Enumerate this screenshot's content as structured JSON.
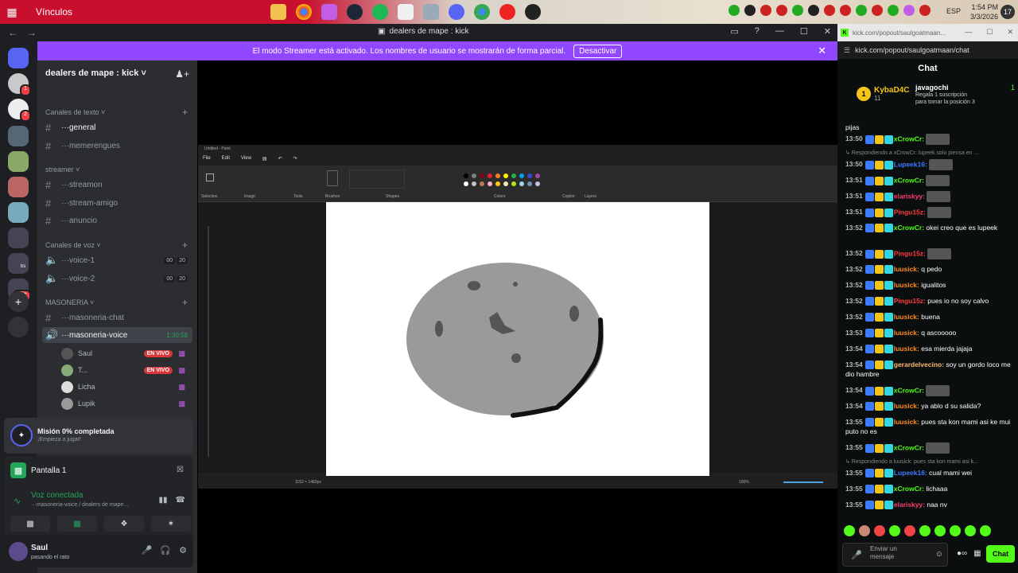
{
  "taskbar": {
    "label": "Vínculos",
    "lang": "ESP",
    "time": "1:54 PM",
    "date": "3/3/2026",
    "badge": "17"
  },
  "discord": {
    "window_title": "dealers de mape : kick",
    "banner_text": "El modo Streamer está activado. Los nombres de usuario se mostrarán de forma parcial.",
    "banner_button": "Desactivar",
    "server_name": "dealers de mape : kick",
    "guild_badges": [
      "1",
      "2",
      "1K+"
    ],
    "guild_label": "bs",
    "categories": {
      "text": "Canales de texto",
      "streamer": "streamer",
      "voice": "Canales de voz",
      "masoneria": "MASONERIA"
    },
    "text_channels": [
      "···general",
      "···memerengues"
    ],
    "streamer_channels": [
      "···streamon",
      "···stream-amigo",
      "···anuncio"
    ],
    "voice_channels": [
      {
        "name": "···voice-1",
        "a": "00",
        "b": "20"
      },
      {
        "name": "···voice-2",
        "a": "00",
        "b": "20"
      }
    ],
    "masoneria_chat": "···masoneria-chat",
    "masoneria_voice": "···masoneria-voice",
    "masoneria_timer": "1:30:59",
    "voice_users": [
      {
        "name": "Saul",
        "live": "EN VIVO"
      },
      {
        "name": "T...",
        "live": "EN VIVO"
      },
      {
        "name": "Licha",
        "live": ""
      },
      {
        "name": "Lupik",
        "live": ""
      }
    ],
    "mission_title": "Misión 0% completada",
    "mission_sub": "¡Empieza a jugar!",
    "screen_label": "Pantalla 1",
    "voice_status": "Voz conectada",
    "voice_sub": "···masoneria-voice / dealers de mape...",
    "user_name": "Saul",
    "user_status": "pasando el rato"
  },
  "paint": {
    "title": "Untitled - Paint",
    "menu": [
      "File",
      "Edit",
      "View"
    ],
    "groups": [
      "Selection",
      "Image",
      "Tools",
      "Brushes",
      "Shapes",
      "Colors",
      "Copilot",
      "Layers"
    ],
    "size": "1152 × 1483px",
    "zoom": "100%",
    "swatch_colors": [
      "#000000",
      "#7f7f7f",
      "#880015",
      "#ed1c24",
      "#ff7f27",
      "#fff200",
      "#22b14c",
      "#00a2e8",
      "#3f48cc",
      "#a349a4",
      "#ffffff",
      "#c3c3c3",
      "#b97a57",
      "#ffaec9",
      "#ffc90e",
      "#efe4b0",
      "#b5e61d",
      "#99d9ea",
      "#7092be",
      "#c8bfe7"
    ]
  },
  "kick": {
    "tab_url": "kick.com/popout/saulgoatmaan...",
    "url": "kick.com/popout/saulgoatmaan/chat",
    "chat_title": "Chat",
    "pinned": {
      "top_user": "KybaD4C",
      "top_count": "11",
      "top_rank": "1",
      "gifter": "javagochi",
      "gift_count": "1",
      "gift_line1": "Regala 1 suscripción",
      "gift_line2": "para tomar la posición 3"
    },
    "messages": [
      {
        "ts": "",
        "user": "",
        "color": "#ffffff",
        "text": "pijas"
      },
      {
        "ts": "13:50",
        "user": "xCrowCr",
        "color": "#53fc18",
        "text": ""
      },
      {
        "reply": "Respondiendo a xCrowCr: lupeek solo piensa en ..."
      },
      {
        "ts": "13:50",
        "user": "Lupeek16",
        "color": "#3d7bff",
        "text": ""
      },
      {
        "ts": "13:51",
        "user": "xCrowCr",
        "color": "#53fc18",
        "text": ""
      },
      {
        "ts": "13:51",
        "user": "elariskyy",
        "color": "#ff3b6b",
        "text": ""
      },
      {
        "ts": "13:51",
        "user": "Pingu15z",
        "color": "#ff3b3b",
        "text": ""
      },
      {
        "ts": "13:52",
        "user": "xCrowCr",
        "color": "#53fc18",
        "text": "okei creo que es lupeek"
      },
      {
        "ts": "13:52",
        "user": "Pingu15z",
        "color": "#ff3b3b",
        "text": ""
      },
      {
        "ts": "13:52",
        "user": "luusick",
        "color": "#ff8c1a",
        "text": "q pedo"
      },
      {
        "ts": "13:52",
        "user": "luusick",
        "color": "#ff8c1a",
        "text": "igualitos"
      },
      {
        "ts": "13:52",
        "user": "Pingu15z",
        "color": "#ff3b3b",
        "text": "pues io no soy calvo"
      },
      {
        "ts": "13:52",
        "user": "luusick",
        "color": "#ff8c1a",
        "text": "buena"
      },
      {
        "ts": "13:53",
        "user": "luusick",
        "color": "#ff8c1a",
        "text": "q ascooooo"
      },
      {
        "ts": "13:54",
        "user": "luusick",
        "color": "#ff8c1a",
        "text": "esa mierda jajaja"
      },
      {
        "ts": "13:54",
        "user": "gerardelvecino",
        "color": "#ffb86b",
        "text": "soy un gordo loco me dio hambre"
      },
      {
        "ts": "13:54",
        "user": "xCrowCr",
        "color": "#53fc18",
        "text": ""
      },
      {
        "ts": "13:54",
        "user": "luusick",
        "color": "#ff8c1a",
        "text": "ya ablo d su salida?"
      },
      {
        "ts": "13:55",
        "user": "luusick",
        "color": "#ff8c1a",
        "text": "pues sta kon mami asi ke mui puto no es"
      },
      {
        "ts": "13:55",
        "user": "xCrowCr",
        "color": "#53fc18",
        "text": ""
      },
      {
        "reply": "Respondiendo a luusick: pues sta kon mami asi k..."
      },
      {
        "ts": "13:55",
        "user": "Lupeek16",
        "color": "#3d7bff",
        "text": "cual mami wei"
      },
      {
        "ts": "13:55",
        "user": "xCrowCr",
        "color": "#53fc18",
        "text": "lichaaa"
      },
      {
        "ts": "13:55",
        "user": "elariskyy",
        "color": "#ff3b6b",
        "text": "naa nv"
      }
    ],
    "input_placeholder": "Enviar un mensaje",
    "chat_button": "Chat"
  }
}
